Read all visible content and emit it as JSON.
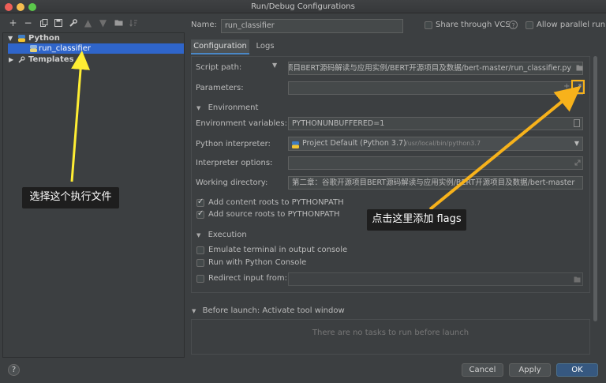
{
  "window": {
    "title": "Run/Debug Configurations",
    "close_color": "#ee5f58",
    "min_color": "#f5bd4f",
    "max_color": "#5bc84b"
  },
  "toolbar": {
    "icons": [
      "plus-icon",
      "minus-icon",
      "copy-icon",
      "save-icon",
      "wrench-icon",
      "arrow-up-icon",
      "arrow-down-icon",
      "folder-icon",
      "sort-icon"
    ],
    "plus": "+",
    "minus": "−"
  },
  "tree": {
    "python": "Python",
    "run_classifier": "run_classifier",
    "templates": "Templates"
  },
  "name": {
    "label": "Name:",
    "value": "run_classifier"
  },
  "share_vcs": "Share through VCS",
  "allow_parallel": "Allow parallel run",
  "tabs": {
    "configuration": "Configuration",
    "logs": "Logs"
  },
  "script_path": {
    "label": "Script path:",
    "value": "项目BERT源码解读与应用实例/BERT开源项目及数据/bert-master/run_classifier.py"
  },
  "parameters": {
    "label": "Parameters:",
    "value": ""
  },
  "environment": {
    "header": "Environment",
    "env_vars_label": "Environment variables:",
    "env_vars_value": "PYTHONUNBUFFERED=1",
    "interpreter_label": "Python interpreter:",
    "interpreter_value": "Project Default (Python 3.7)",
    "interpreter_path": "/usr/local/bin/python3.7",
    "interp_options_label": "Interpreter options:",
    "interp_options_value": "",
    "workdir_label": "Working directory:",
    "workdir_value": "第二章：谷歌开源项目BERT源码解读与应用实例/BERT开源项目及数据/bert-master",
    "content_roots": "Add content roots to PYTHONPATH",
    "source_roots": "Add source roots to PYTHONPATH"
  },
  "execution": {
    "header": "Execution",
    "emulate_terminal": "Emulate terminal in output console",
    "python_console": "Run with Python Console",
    "redirect_input": "Redirect input from:"
  },
  "before_launch": {
    "header": "Before launch: Activate tool window",
    "empty": "There are no tasks to run before launch"
  },
  "buttons": {
    "help": "?",
    "cancel": "Cancel",
    "apply": "Apply",
    "ok": "OK"
  },
  "annotations": {
    "select_file": "选择这个执行文件",
    "add_flags": "点击这里添加 flags",
    "arrow_yellow": "#ffee33",
    "arrow_orange": "#f7b21b"
  }
}
